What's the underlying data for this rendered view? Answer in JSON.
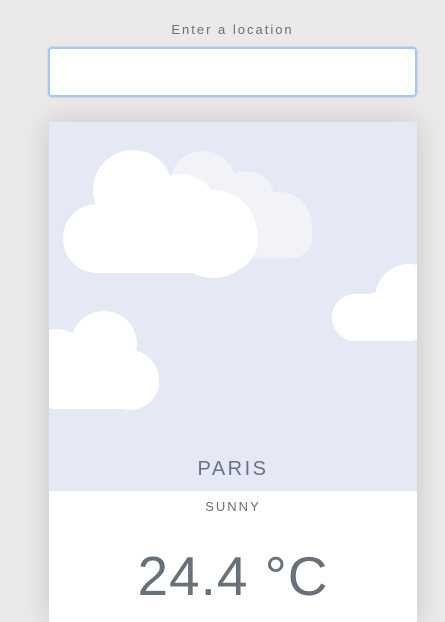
{
  "location_search": {
    "label": "Enter a location",
    "value": "",
    "placeholder": ""
  },
  "weather": {
    "city": "PARIS",
    "condition": "SUNNY",
    "temperature": "24.4 °C",
    "icon": "cloud-icon"
  },
  "colors": {
    "page_background": "#ebeae8",
    "sky_background": "#e5e9f6",
    "cloud": "#ffffff",
    "cloud_faded": "#f1f3f9",
    "text": "#687079",
    "input_focus_border": "#a9c6ef"
  }
}
